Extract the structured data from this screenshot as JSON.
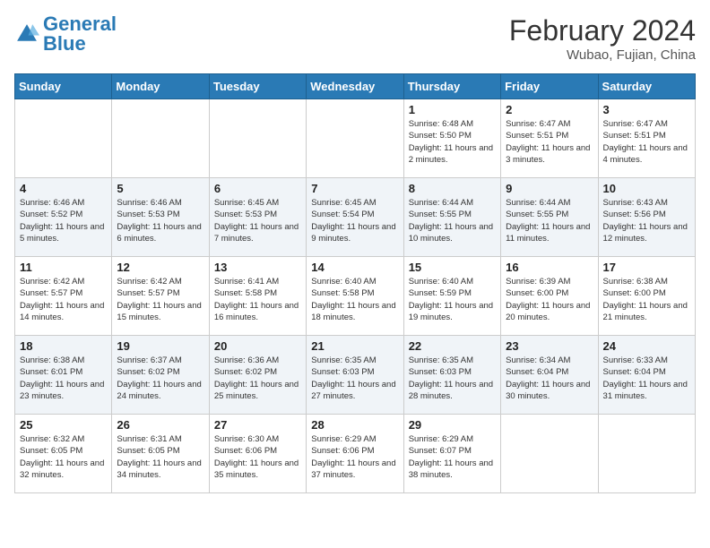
{
  "logo": {
    "general": "General",
    "blue": "Blue"
  },
  "header": {
    "title": "February 2024",
    "subtitle": "Wubao, Fujian, China"
  },
  "days_of_week": [
    "Sunday",
    "Monday",
    "Tuesday",
    "Wednesday",
    "Thursday",
    "Friday",
    "Saturday"
  ],
  "weeks": [
    [
      {
        "day": "",
        "info": ""
      },
      {
        "day": "",
        "info": ""
      },
      {
        "day": "",
        "info": ""
      },
      {
        "day": "",
        "info": ""
      },
      {
        "day": "1",
        "info": "Sunrise: 6:48 AM\nSunset: 5:50 PM\nDaylight: 11 hours and 2 minutes."
      },
      {
        "day": "2",
        "info": "Sunrise: 6:47 AM\nSunset: 5:51 PM\nDaylight: 11 hours and 3 minutes."
      },
      {
        "day": "3",
        "info": "Sunrise: 6:47 AM\nSunset: 5:51 PM\nDaylight: 11 hours and 4 minutes."
      }
    ],
    [
      {
        "day": "4",
        "info": "Sunrise: 6:46 AM\nSunset: 5:52 PM\nDaylight: 11 hours and 5 minutes."
      },
      {
        "day": "5",
        "info": "Sunrise: 6:46 AM\nSunset: 5:53 PM\nDaylight: 11 hours and 6 minutes."
      },
      {
        "day": "6",
        "info": "Sunrise: 6:45 AM\nSunset: 5:53 PM\nDaylight: 11 hours and 7 minutes."
      },
      {
        "day": "7",
        "info": "Sunrise: 6:45 AM\nSunset: 5:54 PM\nDaylight: 11 hours and 9 minutes."
      },
      {
        "day": "8",
        "info": "Sunrise: 6:44 AM\nSunset: 5:55 PM\nDaylight: 11 hours and 10 minutes."
      },
      {
        "day": "9",
        "info": "Sunrise: 6:44 AM\nSunset: 5:55 PM\nDaylight: 11 hours and 11 minutes."
      },
      {
        "day": "10",
        "info": "Sunrise: 6:43 AM\nSunset: 5:56 PM\nDaylight: 11 hours and 12 minutes."
      }
    ],
    [
      {
        "day": "11",
        "info": "Sunrise: 6:42 AM\nSunset: 5:57 PM\nDaylight: 11 hours and 14 minutes."
      },
      {
        "day": "12",
        "info": "Sunrise: 6:42 AM\nSunset: 5:57 PM\nDaylight: 11 hours and 15 minutes."
      },
      {
        "day": "13",
        "info": "Sunrise: 6:41 AM\nSunset: 5:58 PM\nDaylight: 11 hours and 16 minutes."
      },
      {
        "day": "14",
        "info": "Sunrise: 6:40 AM\nSunset: 5:58 PM\nDaylight: 11 hours and 18 minutes."
      },
      {
        "day": "15",
        "info": "Sunrise: 6:40 AM\nSunset: 5:59 PM\nDaylight: 11 hours and 19 minutes."
      },
      {
        "day": "16",
        "info": "Sunrise: 6:39 AM\nSunset: 6:00 PM\nDaylight: 11 hours and 20 minutes."
      },
      {
        "day": "17",
        "info": "Sunrise: 6:38 AM\nSunset: 6:00 PM\nDaylight: 11 hours and 21 minutes."
      }
    ],
    [
      {
        "day": "18",
        "info": "Sunrise: 6:38 AM\nSunset: 6:01 PM\nDaylight: 11 hours and 23 minutes."
      },
      {
        "day": "19",
        "info": "Sunrise: 6:37 AM\nSunset: 6:02 PM\nDaylight: 11 hours and 24 minutes."
      },
      {
        "day": "20",
        "info": "Sunrise: 6:36 AM\nSunset: 6:02 PM\nDaylight: 11 hours and 25 minutes."
      },
      {
        "day": "21",
        "info": "Sunrise: 6:35 AM\nSunset: 6:03 PM\nDaylight: 11 hours and 27 minutes."
      },
      {
        "day": "22",
        "info": "Sunrise: 6:35 AM\nSunset: 6:03 PM\nDaylight: 11 hours and 28 minutes."
      },
      {
        "day": "23",
        "info": "Sunrise: 6:34 AM\nSunset: 6:04 PM\nDaylight: 11 hours and 30 minutes."
      },
      {
        "day": "24",
        "info": "Sunrise: 6:33 AM\nSunset: 6:04 PM\nDaylight: 11 hours and 31 minutes."
      }
    ],
    [
      {
        "day": "25",
        "info": "Sunrise: 6:32 AM\nSunset: 6:05 PM\nDaylight: 11 hours and 32 minutes."
      },
      {
        "day": "26",
        "info": "Sunrise: 6:31 AM\nSunset: 6:05 PM\nDaylight: 11 hours and 34 minutes."
      },
      {
        "day": "27",
        "info": "Sunrise: 6:30 AM\nSunset: 6:06 PM\nDaylight: 11 hours and 35 minutes."
      },
      {
        "day": "28",
        "info": "Sunrise: 6:29 AM\nSunset: 6:06 PM\nDaylight: 11 hours and 37 minutes."
      },
      {
        "day": "29",
        "info": "Sunrise: 6:29 AM\nSunset: 6:07 PM\nDaylight: 11 hours and 38 minutes."
      },
      {
        "day": "",
        "info": ""
      },
      {
        "day": "",
        "info": ""
      }
    ]
  ]
}
